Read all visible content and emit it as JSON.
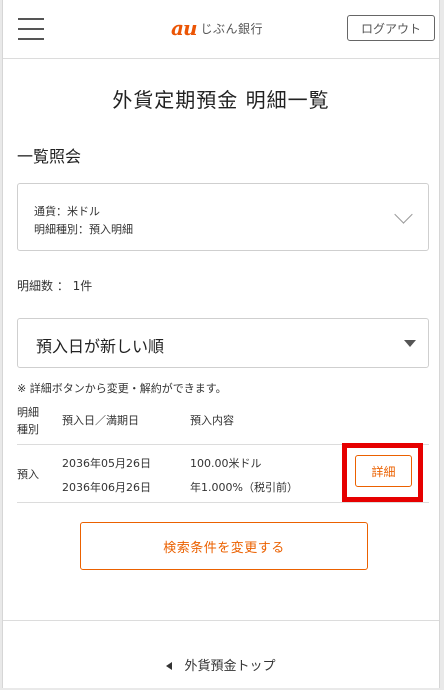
{
  "header": {
    "logo_mark": "au",
    "logo_text": "じぶん銀行",
    "logout_label": "ログアウト",
    "brand_color": "#eb5505"
  },
  "page_title": "外貨定期預金 明細一覧",
  "section_title": "一覧照会",
  "filter": {
    "currency_line": "通貨：米ドル",
    "type_line": "明細種別：預入明細"
  },
  "count_text": "明細数 ： 1件",
  "sort": {
    "selected": "預入日が新しい順"
  },
  "note": "※ 詳細ボタンから変更・解約ができます。",
  "table": {
    "headers": [
      "明細\n種別",
      "預入日／満期日",
      "預入内容"
    ],
    "rows": [
      {
        "type": "預入",
        "deposit_date": "2036年05月26日",
        "maturity_date": "2036年06月26日",
        "amount": "100.00米ドル",
        "rate": "年1.000%（税引前）",
        "button": "詳細"
      }
    ]
  },
  "change_button": "検索条件を変更する",
  "footer_link": "外貨預金トップ",
  "colors": {
    "accent": "#eb6100",
    "highlight": "#e60000"
  }
}
